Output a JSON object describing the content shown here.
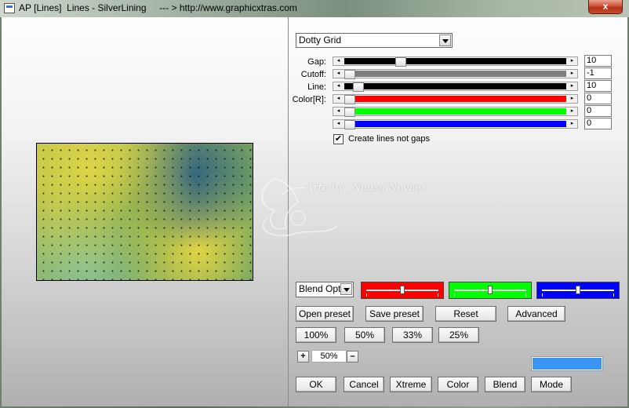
{
  "window": {
    "title": "AP [Lines]  Lines - SilverLining     --- > http://www.graphicxtras.com",
    "close_label": "x",
    "app_icon": "app-icon"
  },
  "filter": {
    "selected": "Dotty Grid"
  },
  "parameters": {
    "gap": {
      "label": "Gap:",
      "value": "10",
      "fraction": 0.24
    },
    "cutoff": {
      "label": "Cutoff:",
      "value": "-1",
      "fraction": 0.0
    },
    "line": {
      "label": "Line:",
      "value": "10",
      "fraction": 0.04
    },
    "color_r": {
      "label": "Color[R]:",
      "value": "0",
      "fraction": 0.0
    },
    "color_g": {
      "label": "",
      "value": "0",
      "fraction": 0.0
    },
    "color_b": {
      "label": "",
      "value": "0",
      "fraction": 0.0
    }
  },
  "option": {
    "checked": true,
    "label": "Create lines not gaps"
  },
  "blend": {
    "selected": "Blend Optio",
    "rgb_levels": [
      0.5,
      0.5,
      0.5
    ],
    "rgb_colors": [
      "#ff0000",
      "#00ff00",
      "#0000ff"
    ]
  },
  "buttons": {
    "open_preset": "Open preset",
    "save_preset": "Save preset",
    "reset": "Reset",
    "advanced": "Advanced",
    "z100": "100%",
    "z50": "50%",
    "z33": "33%",
    "z25": "25%",
    "ok": "OK",
    "cancel": "Cancel",
    "xtreme": "Xtreme",
    "color": "Color",
    "blend": "Blend",
    "mode": "Mode"
  },
  "zoom": {
    "plus": "+",
    "value": "50%",
    "minus": "–"
  },
  "colors": {
    "swatch": "#3b95f5"
  },
  "watermark": {
    "text": "Arte by _Neusa Novaes"
  }
}
